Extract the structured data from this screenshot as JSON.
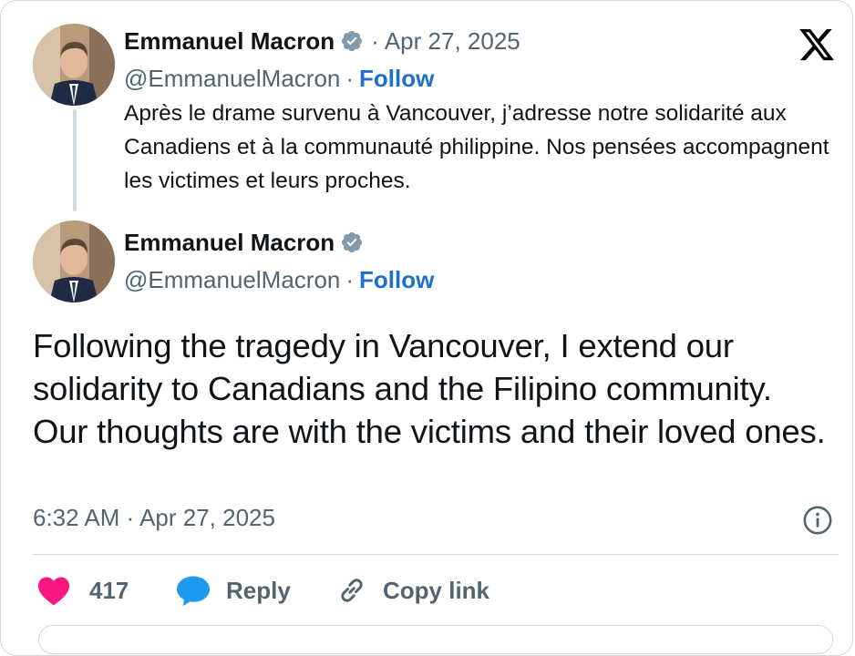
{
  "brand": {
    "logo_icon": "x-logo-icon"
  },
  "quoted_post": {
    "author_name": "Emmanuel Macron",
    "verified_icon": "verified-badge-icon",
    "separator": "·",
    "date": "Apr 27, 2025",
    "handle": "@EmmanuelMacron",
    "follow_label": "Follow",
    "text": "Après le drame survenu à Vancouver, j’adresse notre solidarité aux Canadiens et à la communauté philippine. Nos pensées accompagnent les victimes et leurs proches."
  },
  "main_post": {
    "author_name": "Emmanuel Macron",
    "verified_icon": "verified-badge-icon",
    "handle": "@EmmanuelMacron",
    "separator": "·",
    "follow_label": "Follow",
    "text": "Following the tragedy in Vancouver, I extend our solidarity to Canadians and the Filipino community. Our thoughts are with the victims and their loved ones.",
    "timestamp": "6:32 AM · Apr 27, 2025",
    "info_icon": "info-icon"
  },
  "actions": {
    "like_count": "417",
    "like_icon": "heart-icon",
    "reply_label": "Reply",
    "reply_icon": "speech-bubble-icon",
    "copy_label": "Copy link",
    "copy_icon": "link-icon"
  },
  "colors": {
    "follow": "#1d6fd1",
    "like": "#f91880",
    "reply": "#1d9bf0",
    "secondary_text": "#536471",
    "border": "#cfd9de"
  }
}
